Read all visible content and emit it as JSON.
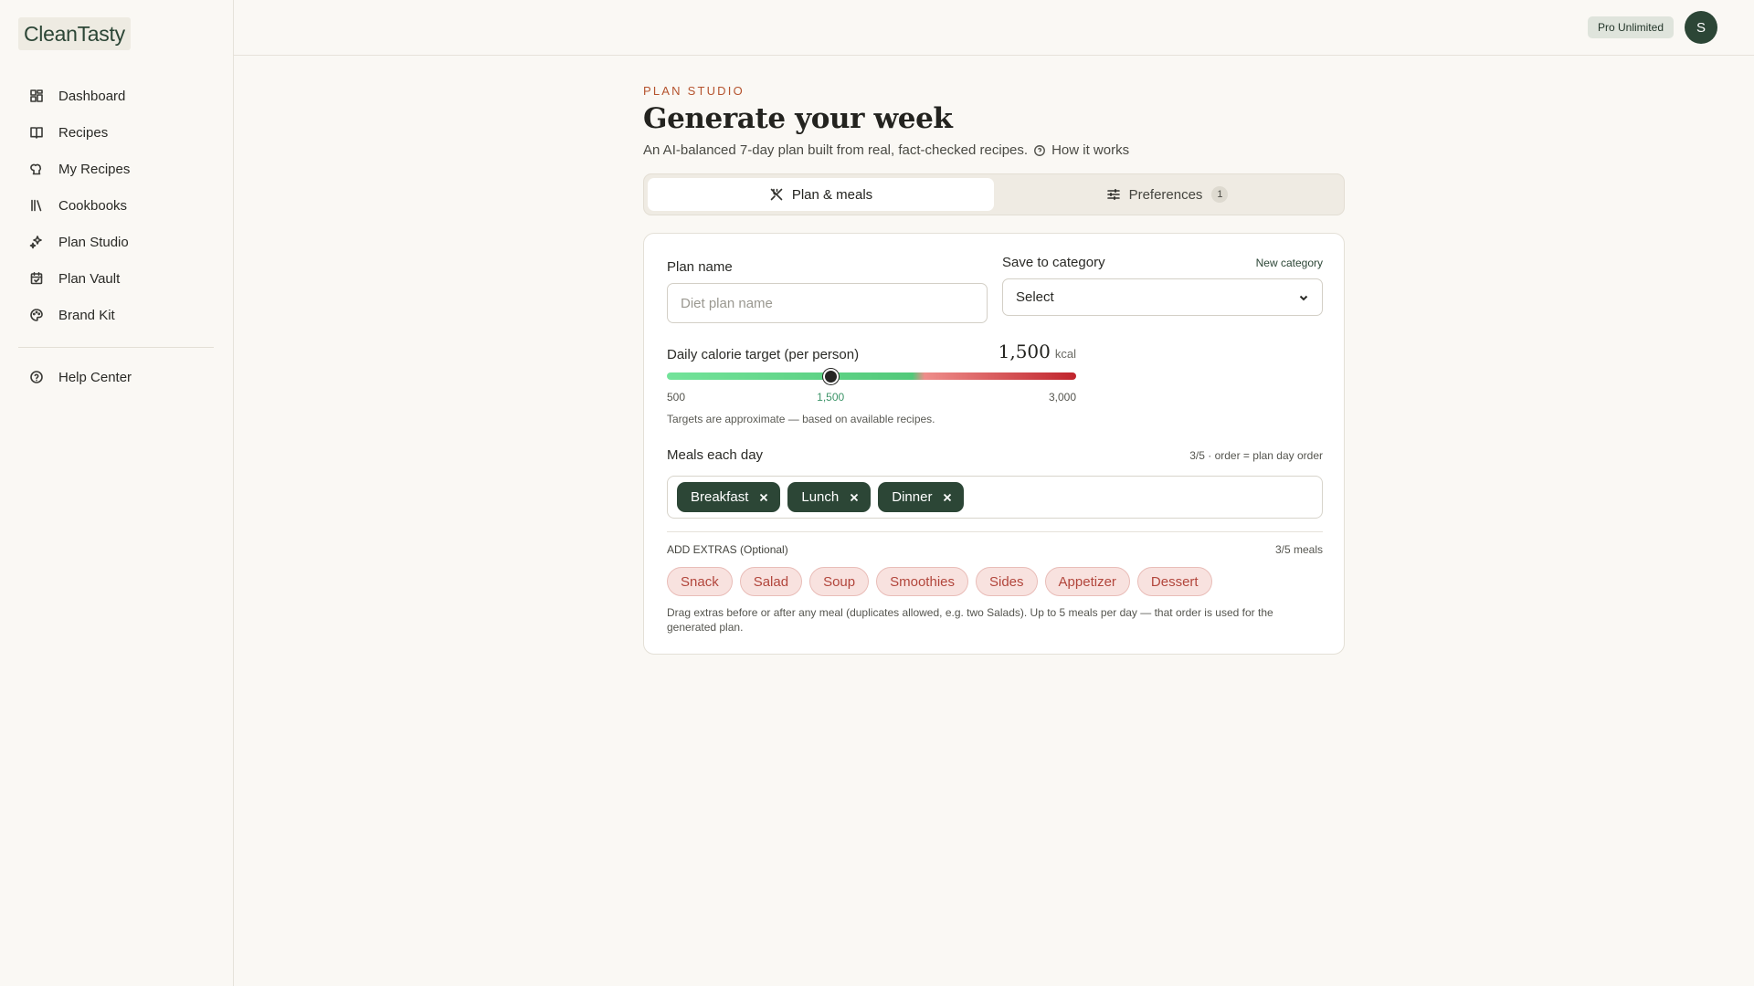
{
  "app": {
    "logo": "CleanTasty"
  },
  "sidebar": {
    "items": [
      {
        "label": "Dashboard",
        "icon": "dashboard-icon"
      },
      {
        "label": "Recipes",
        "icon": "book-icon"
      },
      {
        "label": "My Recipes",
        "icon": "chef-hat-icon"
      },
      {
        "label": "Cookbooks",
        "icon": "library-icon"
      },
      {
        "label": "Plan Studio",
        "icon": "sparkles-icon"
      },
      {
        "label": "Plan Vault",
        "icon": "calendar-icon"
      },
      {
        "label": "Brand Kit",
        "icon": "palette-icon"
      }
    ],
    "help": {
      "label": "Help Center",
      "icon": "help-circle-icon"
    }
  },
  "topbar": {
    "plan_badge": "Pro Unlimited",
    "avatar_initial": "S"
  },
  "header": {
    "eyebrow": "PLAN STUDIO",
    "title": "Generate your week",
    "subtitle": "An AI-balanced 7-day plan built from real, fact-checked recipes.",
    "how_link": "How it works"
  },
  "tabs": [
    {
      "label": "Plan & meals",
      "icon": "utensils-icon",
      "active": true
    },
    {
      "label": "Preferences",
      "icon": "sliders-icon",
      "count": "1",
      "active": false
    }
  ],
  "form": {
    "plan_name": {
      "label": "Plan name",
      "placeholder": "Diet plan name",
      "value": ""
    },
    "category": {
      "label": "Save to category",
      "new_link": "New category",
      "selected": "Select"
    },
    "calories": {
      "label": "Daily calorie target (per person)",
      "value_display": "1,500",
      "unit": "kcal",
      "value": 1500,
      "min": 500,
      "max": 3000,
      "min_label": "500",
      "mid_label": "1,500",
      "max_label": "3,000",
      "note": "Targets are approximate — based on available recipes."
    },
    "meals": {
      "label": "Meals each day",
      "meta": "3/5 · order = plan day order",
      "chips": [
        "Breakfast",
        "Lunch",
        "Dinner"
      ]
    },
    "extras": {
      "title": "ADD EXTRAS (Optional)",
      "meta": "3/5 meals",
      "items": [
        "Snack",
        "Salad",
        "Soup",
        "Smoothies",
        "Sides",
        "Appetizer",
        "Dessert"
      ],
      "hint": "Drag extras before or after any meal (duplicates allowed, e.g. two Salads). Up to 5 meals per day — that order is used for the generated plan."
    }
  },
  "colors": {
    "brand": "#2c4636",
    "accent": "#b5532e",
    "pill_bg": "#f8e2df",
    "pill_text": "#b2463c"
  }
}
